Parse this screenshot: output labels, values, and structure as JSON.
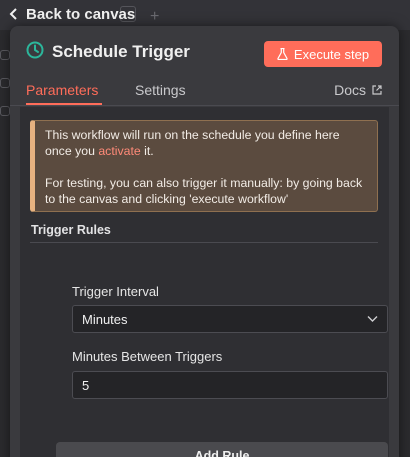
{
  "nav": {
    "back_label": "Back to canvas"
  },
  "header": {
    "title": "Schedule Trigger",
    "execute_label": "Execute step"
  },
  "tabs": {
    "parameters": "Parameters",
    "settings": "Settings",
    "docs": "Docs"
  },
  "notice": {
    "line1_before": "This workflow will run on the schedule you define here once you ",
    "line1_link": "activate",
    "line1_after": " it.",
    "line2": "For testing, you can also trigger it manually: by going back to the canvas and clicking 'execute workflow'"
  },
  "rules": {
    "section_title": "Trigger Rules",
    "interval_label": "Trigger Interval",
    "interval_value": "Minutes",
    "between_label": "Minutes Between Triggers",
    "between_value": "5",
    "add_rule_label": "Add Rule"
  },
  "colors": {
    "accent": "#ff6d5a",
    "panel_bg": "#3a3a3e",
    "notice_bg": "#5b4b3f",
    "notice_border": "#e7b280",
    "clock_icon": "#2cb69b"
  },
  "icons": {
    "back": "chevron-left-icon",
    "clock": "clock-icon",
    "flask": "flask-icon",
    "external": "external-link-icon",
    "chevron": "chevron-down-icon"
  }
}
